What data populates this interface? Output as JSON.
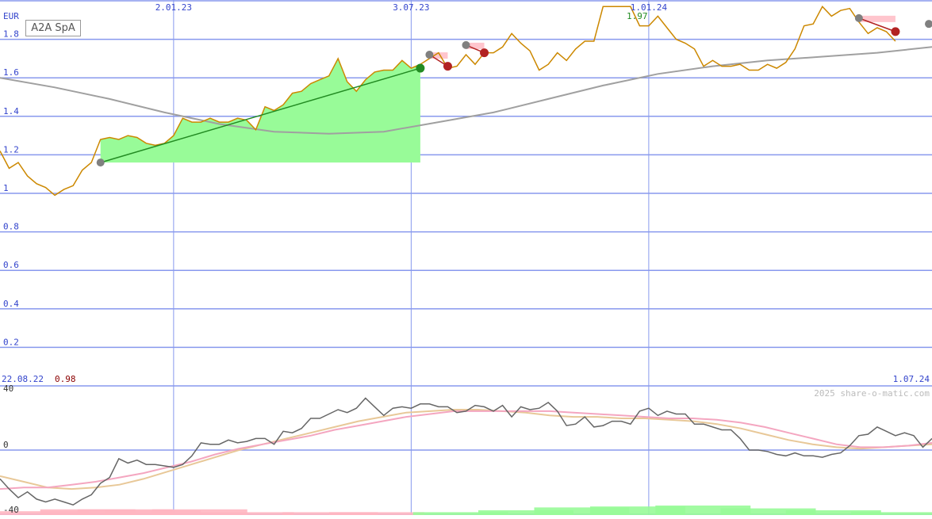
{
  "chart_data": [
    {
      "type": "line",
      "title": "A2A SpA",
      "ylabel": "EUR",
      "ylim": [
        0,
        2.0
      ],
      "yticks": [
        "0.2",
        "0.4",
        "0.6",
        "0.8",
        "1",
        "1.2",
        "1.4",
        "1.6",
        "1.8"
      ],
      "ytick_values": [
        0.2,
        0.4,
        0.6,
        0.8,
        1.0,
        1.2,
        1.4,
        1.6,
        1.8
      ],
      "xlim": [
        "22.08.22",
        "10.08.24"
      ],
      "xticks": [
        "2.01.23",
        "3.07.23",
        "1.01.24"
      ],
      "xtick_dates": [
        "2023-01-02",
        "2023-07-03",
        "2024-01-01"
      ],
      "start_label": "22.08.22",
      "end_label": "1.07.24",
      "min_label": "0.98",
      "max_label": "1.97",
      "grid": true,
      "colors": {
        "price": "#cc8800",
        "ma": "#a0a0a0",
        "grid": "#8899ee",
        "gain_fill": "#98fb98",
        "gain_line": "#228b22",
        "loss": "#b22222",
        "loss_fill": "#ffb6c1",
        "marker_gray": "#808080",
        "min_text": "#8b0000",
        "max_text": "#228b22"
      },
      "series": [
        {
          "role": "price",
          "x": [
            "2022-08-22",
            "2022-08-29",
            "2022-09-05",
            "2022-09-12",
            "2022-09-19",
            "2022-09-26",
            "2022-10-03",
            "2022-10-10",
            "2022-10-17",
            "2022-10-24",
            "2022-10-31",
            "2022-11-07",
            "2022-11-14",
            "2022-11-21",
            "2022-11-28",
            "2022-12-05",
            "2022-12-12",
            "2022-12-19",
            "2022-12-26",
            "2023-01-02",
            "2023-01-09",
            "2023-01-16",
            "2023-01-23",
            "2023-01-30",
            "2023-02-06",
            "2023-02-13",
            "2023-02-20",
            "2023-02-27",
            "2023-03-06",
            "2023-03-13",
            "2023-03-20",
            "2023-03-27",
            "2023-04-03",
            "2023-04-10",
            "2023-04-17",
            "2023-04-24",
            "2023-05-01",
            "2023-05-08",
            "2023-05-15",
            "2023-05-22",
            "2023-05-29",
            "2023-06-05",
            "2023-06-12",
            "2023-06-19",
            "2023-06-26",
            "2023-07-03",
            "2023-07-10",
            "2023-07-17",
            "2023-07-24",
            "2023-07-31",
            "2023-08-07",
            "2023-08-14",
            "2023-08-21",
            "2023-08-28",
            "2023-09-04",
            "2023-09-11",
            "2023-09-18",
            "2023-09-25",
            "2023-10-02",
            "2023-10-09",
            "2023-10-16",
            "2023-10-23",
            "2023-10-30",
            "2023-11-06",
            "2023-11-13",
            "2023-11-20",
            "2023-11-27",
            "2023-12-04",
            "2023-12-11",
            "2023-12-18",
            "2023-12-25",
            "2024-01-01",
            "2024-01-08",
            "2024-01-15",
            "2024-01-22",
            "2024-01-29",
            "2024-02-05",
            "2024-02-12",
            "2024-02-19",
            "2024-02-26",
            "2024-03-04",
            "2024-03-11",
            "2024-03-18",
            "2024-03-25",
            "2024-04-01",
            "2024-04-08",
            "2024-04-15",
            "2024-04-22",
            "2024-04-29",
            "2024-05-06",
            "2024-05-13",
            "2024-05-20",
            "2024-05-27",
            "2024-06-03",
            "2024-06-10",
            "2024-06-17",
            "2024-06-24",
            "2024-07-01",
            "2024-07-08"
          ],
          "y": [
            1.22,
            1.13,
            1.16,
            1.09,
            1.05,
            1.03,
            0.99,
            1.02,
            1.04,
            1.12,
            1.16,
            1.28,
            1.29,
            1.28,
            1.3,
            1.29,
            1.26,
            1.25,
            1.26,
            1.3,
            1.39,
            1.37,
            1.37,
            1.39,
            1.37,
            1.37,
            1.39,
            1.38,
            1.33,
            1.45,
            1.43,
            1.46,
            1.52,
            1.53,
            1.57,
            1.59,
            1.61,
            1.7,
            1.58,
            1.53,
            1.59,
            1.63,
            1.64,
            1.64,
            1.69,
            1.65,
            1.67,
            1.7,
            1.73,
            1.65,
            1.66,
            1.72,
            1.67,
            1.73,
            1.73,
            1.76,
            1.83,
            1.78,
            1.74,
            1.64,
            1.67,
            1.73,
            1.69,
            1.75,
            1.79,
            1.79,
            1.97,
            1.97,
            1.97,
            1.97,
            1.87,
            1.87,
            1.92,
            1.86,
            1.8,
            1.78,
            1.75,
            1.66,
            1.69,
            1.66,
            1.66,
            1.67,
            1.64,
            1.64,
            1.67,
            1.65,
            1.68,
            1.75,
            1.87,
            1.88,
            1.97,
            1.92,
            1.95,
            1.96,
            1.89,
            1.83,
            1.86,
            1.84,
            1.79
          ]
        },
        {
          "role": "moving-average",
          "x": [
            "2022-08-22",
            "2022-10-03",
            "2022-11-14",
            "2022-12-26",
            "2023-02-06",
            "2023-03-20",
            "2023-05-01",
            "2023-06-12",
            "2023-07-24",
            "2023-09-04",
            "2023-10-16",
            "2023-11-27",
            "2024-01-08",
            "2024-02-19",
            "2024-04-01",
            "2024-05-13",
            "2024-06-24",
            "2024-08-05"
          ],
          "y": [
            1.6,
            1.55,
            1.49,
            1.42,
            1.36,
            1.32,
            1.31,
            1.32,
            1.37,
            1.42,
            1.49,
            1.56,
            1.62,
            1.66,
            1.69,
            1.71,
            1.73,
            1.76
          ]
        }
      ],
      "signals": [
        {
          "type": "gain",
          "from": {
            "x": "2022-11-07",
            "y": 1.16
          },
          "to": {
            "x": "2023-07-10",
            "y": 1.65
          }
        },
        {
          "type": "loss",
          "from": {
            "x": "2023-07-17",
            "y": 1.72
          },
          "to": {
            "x": "2023-07-31",
            "y": 1.66
          }
        },
        {
          "type": "loss",
          "from": {
            "x": "2023-08-14",
            "y": 1.77
          },
          "to": {
            "x": "2023-08-28",
            "y": 1.73
          }
        },
        {
          "type": "loss",
          "from": {
            "x": "2024-06-10",
            "y": 1.91
          },
          "to": {
            "x": "2024-07-08",
            "y": 1.84
          }
        },
        {
          "type": "open",
          "from": {
            "x": "2024-08-05",
            "y": 1.88
          },
          "to": null
        }
      ]
    },
    {
      "type": "line",
      "role": "indicator",
      "ylim": [
        -40,
        40
      ],
      "yticks": [
        "40",
        "0",
        "-40"
      ],
      "ytick_values": [
        40,
        0,
        -40
      ],
      "colors": {
        "osc": "#666666",
        "sig1": "#f4a6c0",
        "sig2": "#e8c898",
        "pos_bar": "#98fb98",
        "neg_bar": "#ffb6c1"
      },
      "series": [
        {
          "role": "oscillator",
          "y": [
            -20,
            -27,
            -33,
            -29,
            -34,
            -36,
            -34,
            -36,
            -38,
            -34,
            -31,
            -23,
            -19,
            -6,
            -9,
            -7,
            -10,
            -10,
            -11,
            -12,
            -10,
            -4,
            5,
            4,
            4,
            7,
            5,
            6,
            8,
            8,
            4,
            13,
            12,
            15,
            22,
            22,
            25,
            28,
            26,
            29,
            36,
            30,
            24,
            29,
            30,
            29,
            32,
            32,
            30,
            30,
            26,
            27,
            31,
            30,
            27,
            31,
            23,
            30,
            28,
            29,
            33,
            27,
            17,
            18,
            23,
            16,
            17,
            20,
            20,
            18,
            27,
            29,
            24,
            27,
            25,
            25,
            18,
            18,
            16,
            14,
            14,
            8,
            0,
            0,
            -1,
            -3,
            -4,
            -2,
            -4,
            -4,
            -5,
            -3,
            -2,
            3,
            10,
            11,
            16,
            13,
            10,
            12,
            10,
            2,
            8
          ]
        },
        {
          "role": "signal-1",
          "y": [
            -27,
            -26,
            -26,
            -24,
            -22,
            -19,
            -16,
            -12,
            -8,
            -3,
            1,
            4,
            7,
            10,
            14,
            17,
            20,
            23,
            25,
            27,
            27,
            27,
            27,
            27,
            26,
            25,
            24,
            23,
            22,
            22,
            21,
            19,
            16,
            12,
            8,
            4,
            2,
            2,
            3,
            5
          ]
        },
        {
          "role": "signal-2",
          "y": [
            -18,
            -22,
            -26,
            -27,
            -26,
            -24,
            -20,
            -15,
            -10,
            -5,
            0,
            4,
            8,
            12,
            16,
            20,
            23,
            26,
            27,
            28,
            28,
            27,
            26,
            24,
            23,
            23,
            22,
            22,
            21,
            20,
            18,
            15,
            11,
            7,
            4,
            2,
            1,
            2,
            3,
            4
          ]
        },
        {
          "role": "histogram-negative",
          "segments": [
            [
              0,
              0.4
            ],
            [
              0.5,
              0.6
            ],
            [
              0.9,
              0.6
            ],
            [
              1.2,
              0.5
            ],
            [
              1.7,
              0.6
            ],
            [
              2.2,
              0.3
            ],
            [
              3.1,
              0.3
            ],
            [
              3.6,
              0.3
            ]
          ]
        },
        {
          "role": "histogram-positive",
          "segments": [
            [
              4.5,
              0.3
            ],
            [
              5.2,
              0.5
            ],
            [
              5.8,
              0.8
            ],
            [
              6.4,
              0.9
            ],
            [
              7.1,
              1.0
            ],
            [
              7.8,
              0.7
            ],
            [
              8.5,
              0.5
            ],
            [
              9.2,
              0.3
            ]
          ]
        }
      ],
      "copyright": "2025 share-o-matic.com"
    }
  ]
}
